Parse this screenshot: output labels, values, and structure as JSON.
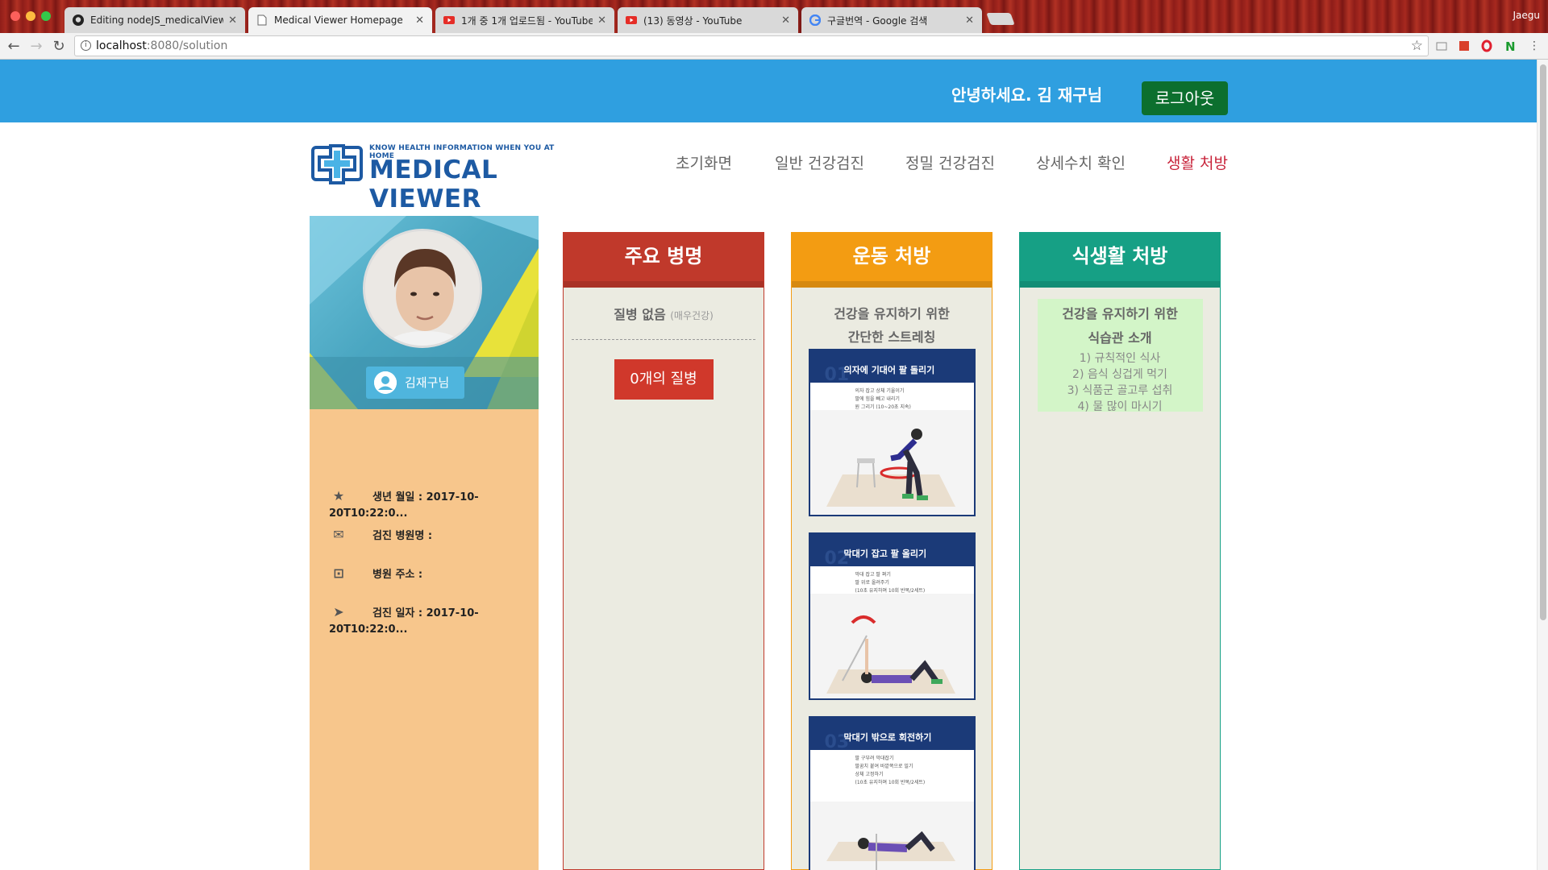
{
  "browser": {
    "tabs": [
      {
        "title": "Editing nodeJS_medicalViewer",
        "icon": "github-icon"
      },
      {
        "title": "Medical Viewer Homepage",
        "icon": "page-icon"
      },
      {
        "title": "1개 중 1개 업로드됨 - YouTube",
        "icon": "youtube-icon"
      },
      {
        "title": "(13) 동영상 - YouTube",
        "icon": "youtube-icon"
      },
      {
        "title": "구글번역 - Google 검색",
        "icon": "google-icon"
      }
    ],
    "user": "Jaegu",
    "url_host": "localhost",
    "url_rest": ":8080/solution"
  },
  "header": {
    "greeting": "안녕하세요. 김 재구님",
    "logout": "로그아웃"
  },
  "logo": {
    "tagline": "KNOW HEALTH INFORMATION WHEN YOU AT HOME",
    "name": "MEDICAL VIEWER"
  },
  "nav": [
    "초기화면",
    "일반 건강검진",
    "정밀 건강검진",
    "상세수치 확인",
    "생활 처방"
  ],
  "profile": {
    "name": "김재구님",
    "rows": [
      {
        "icon": "star-icon",
        "label": "생년 월일 : 2017-10-20T10:22:0..."
      },
      {
        "icon": "envelope-icon",
        "label": "검진 병원명 :"
      },
      {
        "icon": "inbox-icon",
        "label": "병원 주소 :"
      },
      {
        "icon": "send-icon",
        "label": "검진 일자 : 2017-10-20T10:22:0..."
      }
    ]
  },
  "disease": {
    "title": "주요 병명",
    "none": "질병 없음",
    "none_note": "(매우건강)",
    "count_button": "0개의 질병"
  },
  "exercise": {
    "title": "운동 처방",
    "subtitle_1": "건강을 유지하기 위한",
    "subtitle_2": "간단한 스트레칭",
    "cards": [
      {
        "num": "01",
        "title": "의자에 기대어 팔 돌리기",
        "steps": [
          "의자 잡고 상체 기울이기",
          "팔에 힘을 빼고 내리기",
          "원 그리기 (10~20초 지속)"
        ]
      },
      {
        "num": "02",
        "title": "막대기 잡고 팔 올리기",
        "steps": [
          "막대 잡고 팔 펴기",
          "팔 위로 올려주기",
          "(10초 유지하며 10회 반복/2세트)"
        ]
      },
      {
        "num": "03",
        "title": "막대기 밖으로 회전하기",
        "steps": [
          "팔 구부려 막대잡기",
          "팔꿈치 붙여 바깥쪽으로 밀기",
          "상체 고정하기",
          "(10초 유지하며 10회 반복/2세트)"
        ]
      }
    ]
  },
  "diet": {
    "title": "식생활 처방",
    "subtitle_1": "건강을 유지하기 위한",
    "subtitle_2": "식습관 소개",
    "items": [
      "1) 규칙적인 식사",
      "2) 음식 싱겁게 먹기",
      "3) 식품군 골고루 섭취",
      "4) 물 많이 마시기"
    ]
  },
  "colors": {
    "top_band": "#2f9fe0",
    "logout": "#0c6f2e",
    "disease_accent": "#c0392b",
    "exercise_accent": "#f39c12",
    "diet_accent": "#16a085",
    "profile_bg": "#f7c68c",
    "nav_active": "#c8243b"
  }
}
